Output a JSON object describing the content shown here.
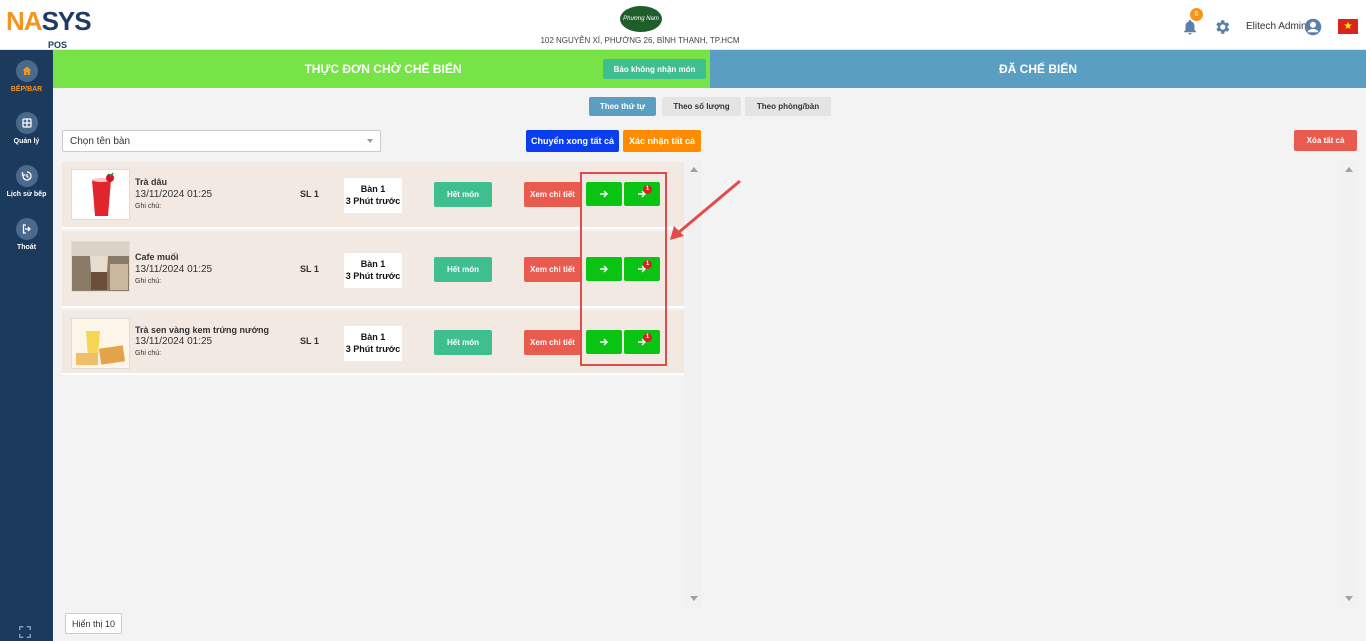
{
  "header": {
    "logo_main": "NA",
    "logo_accent": "SYS",
    "logo_sub": "POS",
    "store_emblem": "Phương Nam",
    "store_address": "102 NGUYỄN XÍ, PHƯỜNG 26, BÌNH THẠNH, TP.HCM",
    "notification_count": "6",
    "user_name": "Elitech Admin",
    "language_flag": "vietnam-flag"
  },
  "sidebar": {
    "items": [
      {
        "label": "BẾP/BAR",
        "icon": "home-icon",
        "active": true
      },
      {
        "label": "Quản lý",
        "icon": "grid-icon",
        "active": false
      },
      {
        "label": "Lịch sử bếp",
        "icon": "history-icon",
        "active": false
      },
      {
        "label": "Thoát",
        "icon": "logout-icon",
        "active": false
      }
    ]
  },
  "tabs": {
    "pending": "THỰC ĐƠN CHỜ CHẾ BIẾN",
    "report": "Báo không nhận món",
    "done": "ĐÃ CHẾ BIẾN"
  },
  "sort": {
    "by_order": "Theo thứ tự",
    "by_quantity": "Theo số lượng",
    "by_room": "Theo phòng/bàn"
  },
  "filters": {
    "table_select": "Chọn tên bàn"
  },
  "actions": {
    "move_all": "Chuyển xong tất cả",
    "confirm_all": "Xác nhận tất cả",
    "clear_all": "Xóa tất cả"
  },
  "orders": [
    {
      "name": "Trà dâu",
      "date": "13/11/2024 01:25",
      "note": "Ghi chú:",
      "qty": "SL 1",
      "table": "Bàn 1",
      "elapsed": "3 Phút trước",
      "out_label": "Hết món",
      "detail_label": "Xem chi tiết",
      "badge": "1"
    },
    {
      "name": "Cafe muối",
      "date": "13/11/2024 01:25",
      "note": "Ghi chú:",
      "qty": "SL 1",
      "table": "Bàn 1",
      "elapsed": "3 Phút trước",
      "out_label": "Hết món",
      "detail_label": "Xem chi tiết",
      "badge": "1"
    },
    {
      "name": "Trà sen vàng kem trứng nướng",
      "date": "13/11/2024 01:25",
      "note": "Ghi chú:",
      "qty": "SL 1",
      "table": "Bàn 1",
      "elapsed": "3 Phút trước",
      "out_label": "Hết món",
      "detail_label": "Xem chi tiết",
      "badge": "1"
    }
  ],
  "footer": {
    "show_count": "Hiển thị 10"
  },
  "colors": {
    "pending_tab": "#76e346",
    "done_tab": "#5a9fc2",
    "sidebar": "#1c3a5c",
    "primary_green": "#0ac414",
    "danger": "#ea5b4f",
    "brand_orange": "#f7941d"
  }
}
